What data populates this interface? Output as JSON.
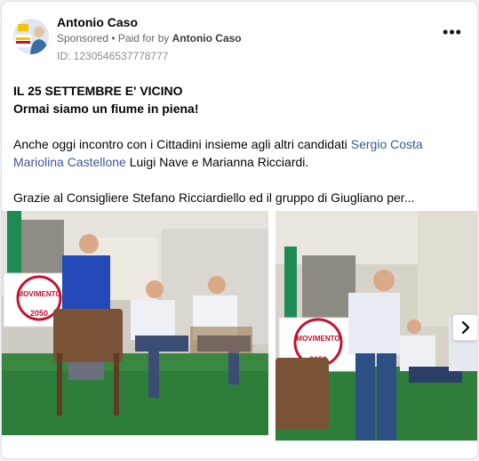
{
  "post": {
    "author": "Antonio Caso",
    "sponsored": "Sponsored",
    "separator": " • ",
    "paid_for_prefix": "Paid for by ",
    "paid_for_name": "Antonio Caso",
    "ad_id": "ID: 1230546537778777",
    "headline": "IL 25 SETTEMBRE E' VICINO",
    "subheadline": "Ormai siamo un fiume in piena!",
    "para1_start": "Anche oggi incontro con i Cittadini insieme agli altri candidati ",
    "link1": "Sergio Costa",
    "link2": "Mariolina Castellone",
    "para1_end": " Luigi Nave e Marianna Ricciardi.",
    "para2": "Grazie al Consigliere Stefano Ricciardiello ed il gruppo di Giugliano per..."
  },
  "images": {
    "banner_text": "MOVIMENTO",
    "banner_year": "2050"
  },
  "icons": {
    "more": "more-options-icon",
    "next": "chevron-right-icon"
  },
  "colors": {
    "link": "#385898",
    "banner_red": "#c8102e",
    "banner_yellow": "#f2c500"
  }
}
